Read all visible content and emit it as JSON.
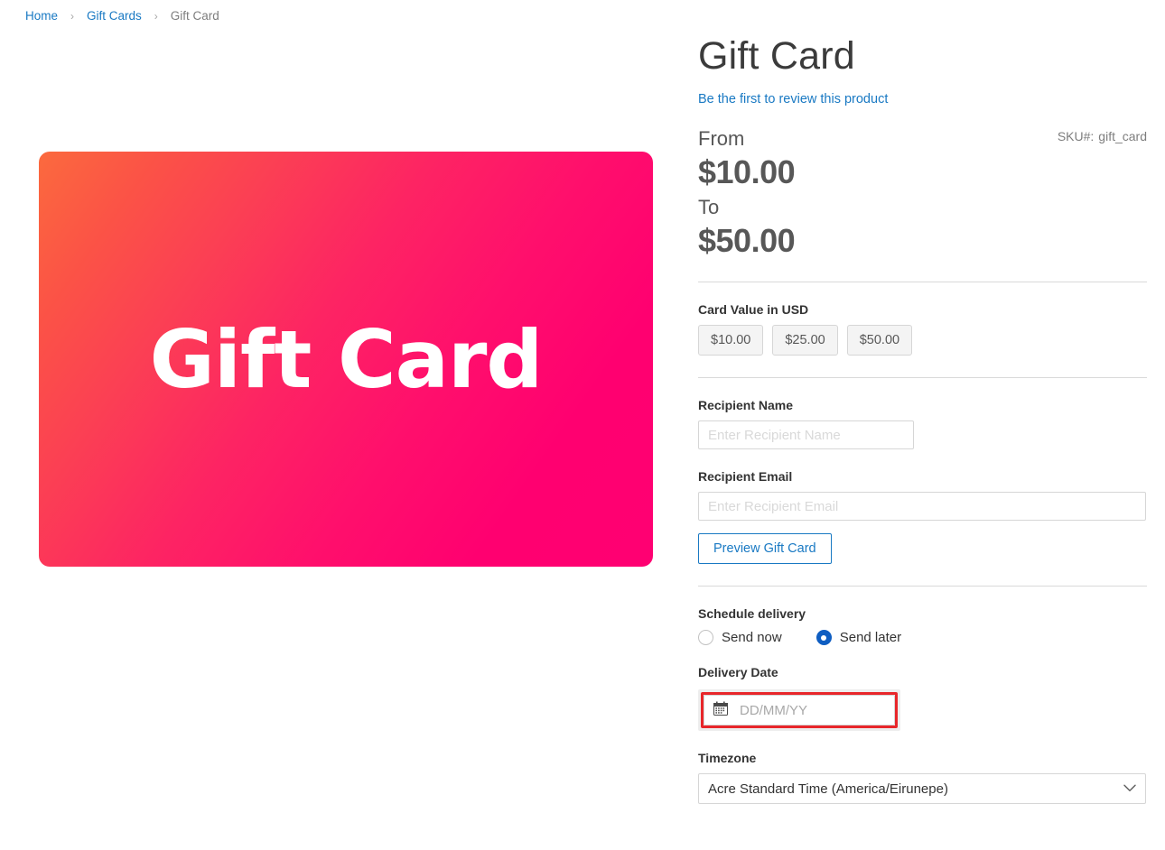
{
  "breadcrumb": {
    "items": [
      {
        "label": "Home",
        "current": false
      },
      {
        "label": "Gift Cards",
        "current": false
      },
      {
        "label": "Gift Card",
        "current": true
      }
    ],
    "separator": "›"
  },
  "gallery": {
    "card_text": "Gift Card",
    "gradient_from": "#fb6a3e",
    "gradient_to": "#ff0072"
  },
  "product": {
    "title": "Gift Card",
    "review_link": "Be the first to review this product",
    "sku_label": "SKU#:",
    "sku_value": "gift_card",
    "price_from_label": "From",
    "price_from_value": "$10.00",
    "price_to_label": "To",
    "price_to_value": "$50.00"
  },
  "card_value": {
    "label": "Card Value in USD",
    "options": [
      {
        "label": "$10.00"
      },
      {
        "label": "$25.00"
      },
      {
        "label": "$50.00"
      }
    ]
  },
  "recipient": {
    "name_label": "Recipient Name",
    "name_placeholder": "Enter Recipient Name",
    "name_value": "",
    "email_label": "Recipient Email",
    "email_placeholder": "Enter Recipient Email",
    "email_value": "",
    "preview_button": "Preview Gift Card"
  },
  "schedule": {
    "label": "Schedule delivery",
    "options": [
      {
        "label": "Send now",
        "selected": false
      },
      {
        "label": "Send later",
        "selected": true
      }
    ],
    "date_label": "Delivery Date",
    "date_placeholder": "DD/MM/YY",
    "date_value": "",
    "timezone_label": "Timezone",
    "timezone_value": "Acre Standard Time (America/Eirunepe)"
  },
  "colors": {
    "link": "#1979c3",
    "radio_selected": "#0f5ec2",
    "highlight": "#e8262a",
    "divider": "#d9d9d9"
  }
}
